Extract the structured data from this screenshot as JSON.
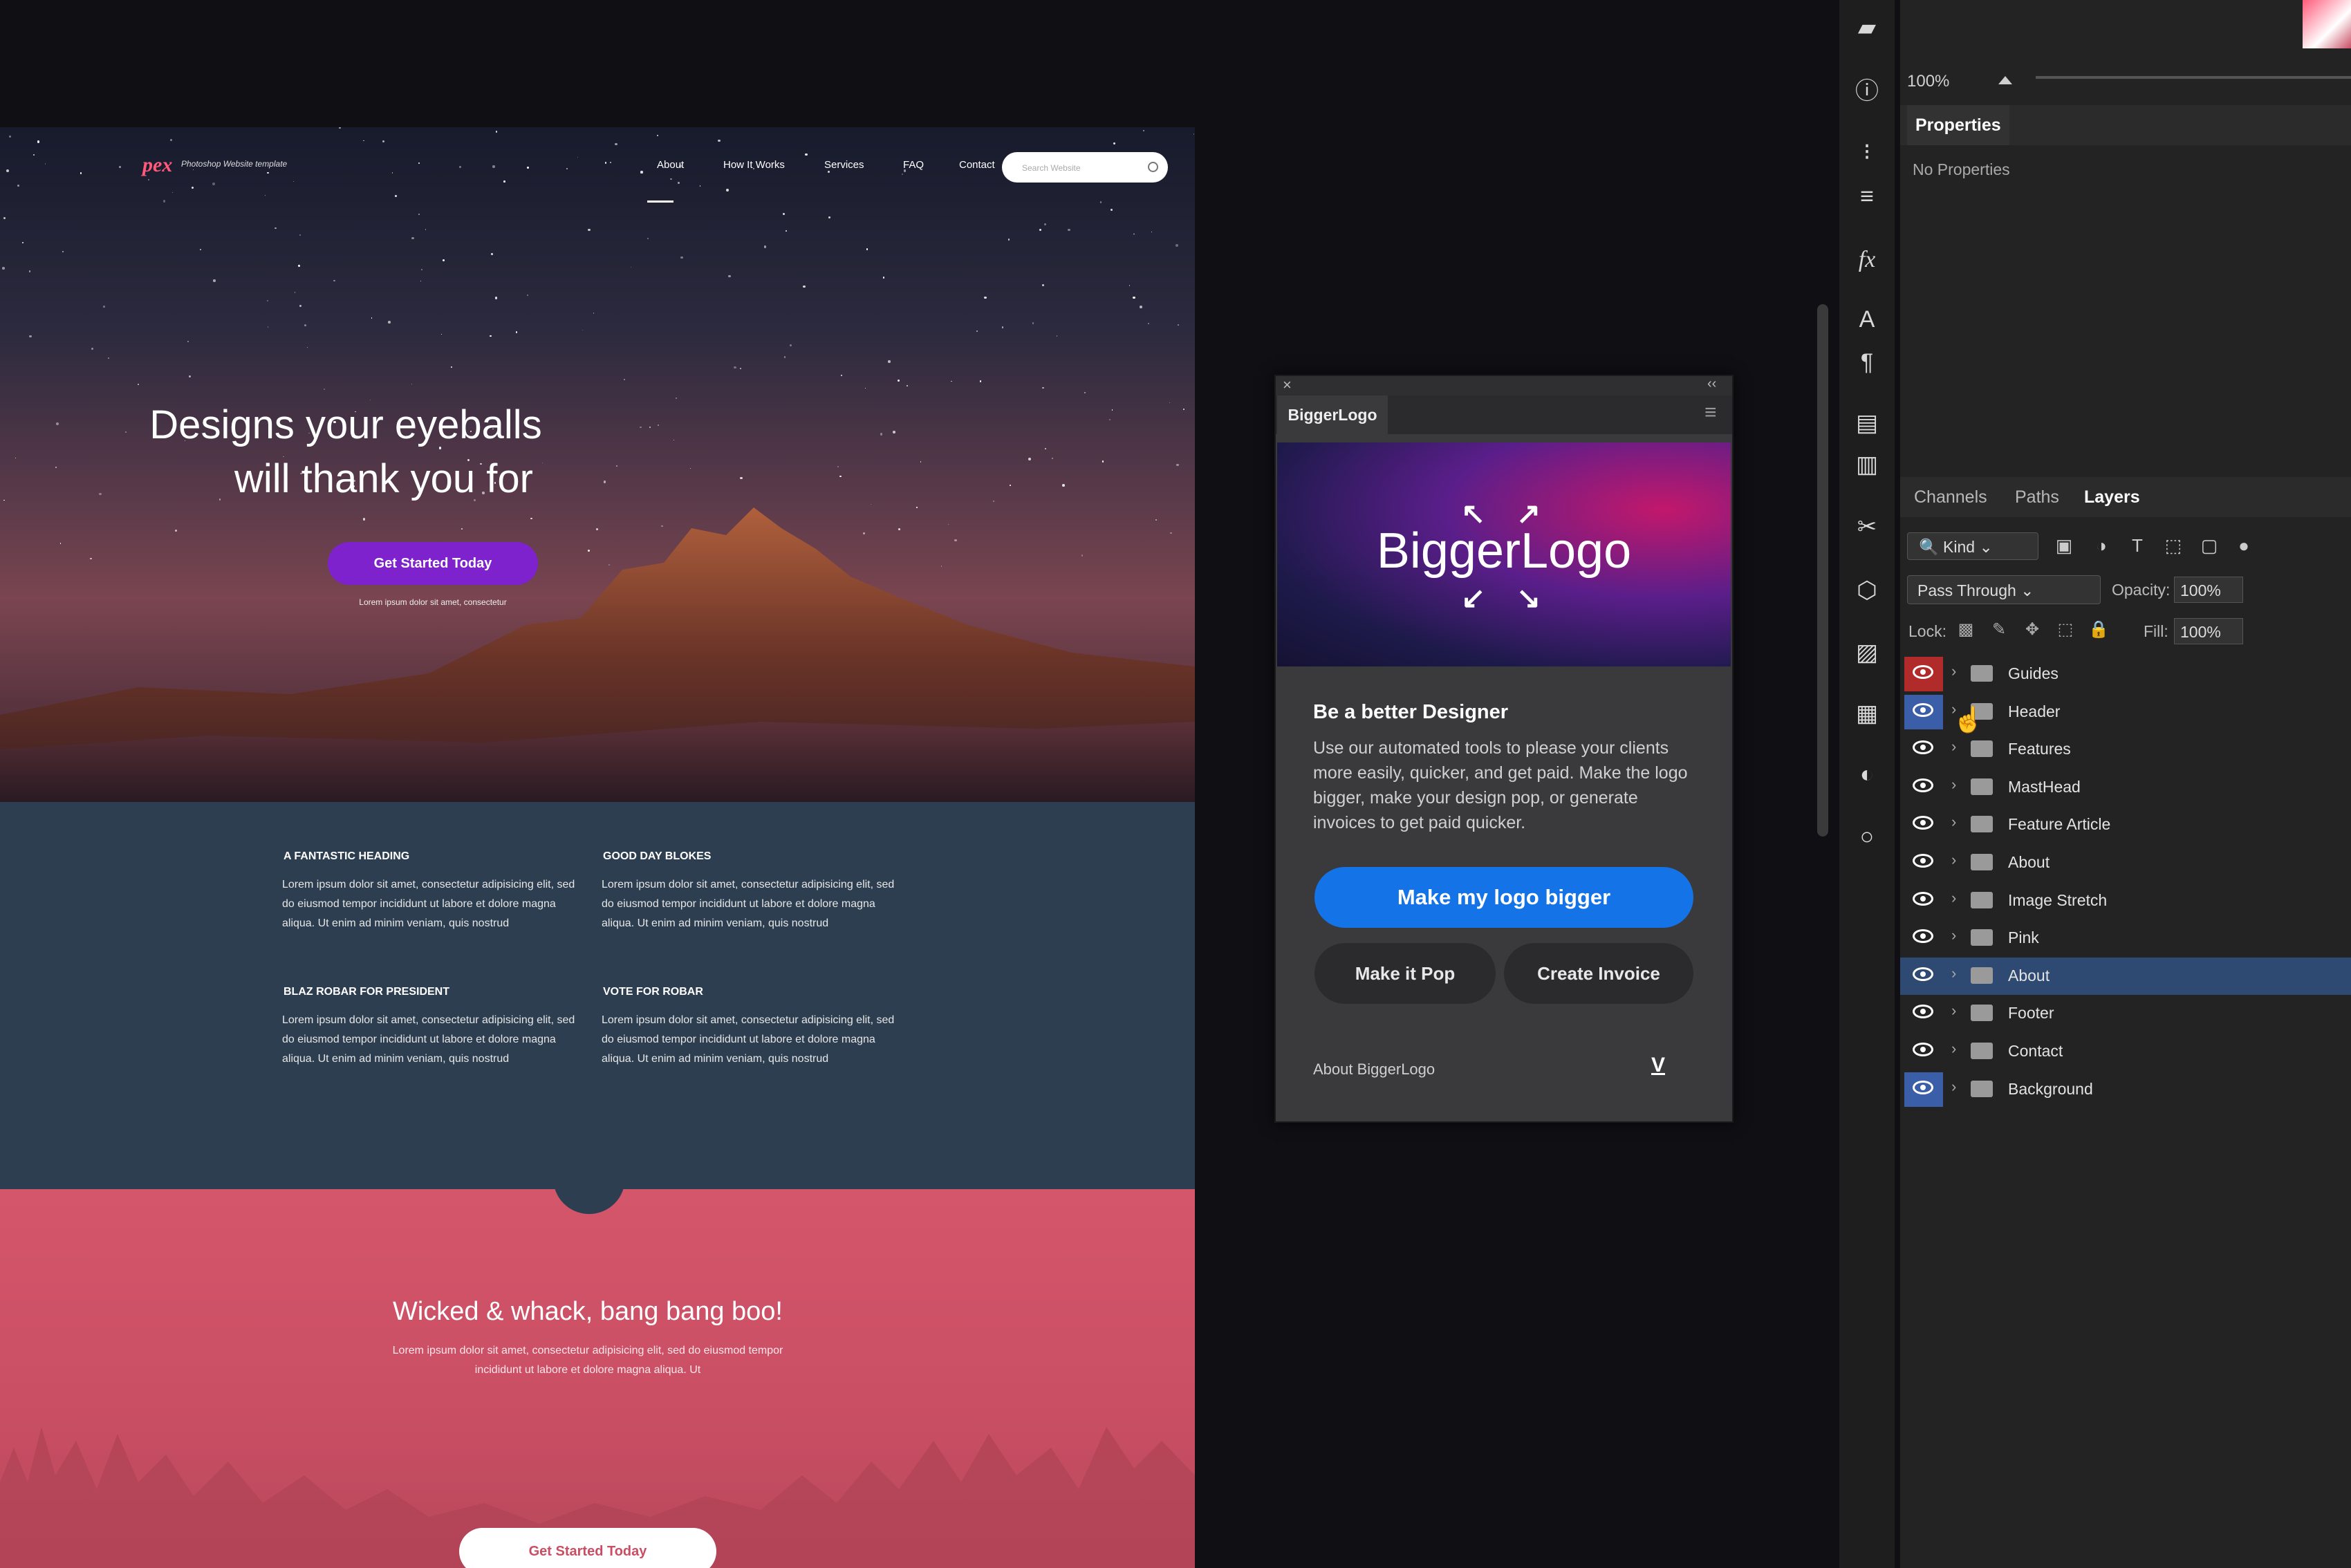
{
  "website": {
    "logo": "pex",
    "logo_sub": "Photoshop Website template",
    "nav": [
      "About",
      "How It Works",
      "Services",
      "FAQ",
      "Contact"
    ],
    "search_placeholder": "Search Website",
    "hero_title_1": "Designs your eyeballs",
    "hero_title_2": "will thank you for",
    "hero_cta": "Get Started Today",
    "hero_small": "Lorem ipsum dolor sit amet, consectetur",
    "features": [
      {
        "heading": "A FANTASTIC HEADING",
        "text": "Lorem ipsum dolor sit amet, consectetur adipisicing elit, sed do eiusmod tempor incididunt ut labore et dolore magna aliqua. Ut enim ad minim veniam, quis nostrud"
      },
      {
        "heading": "GOOD DAY BLOKES",
        "text": "Lorem ipsum dolor sit amet, consectetur adipisicing elit, sed do eiusmod tempor incididunt ut labore et dolore magna aliqua. Ut enim ad minim veniam, quis nostrud"
      },
      {
        "heading": "BLAZ ROBAR FOR PRESIDENT",
        "text": "Lorem ipsum dolor sit amet, consectetur adipisicing elit, sed do eiusmod tempor incididunt ut labore et dolore magna aliqua. Ut enim ad minim veniam, quis nostrud"
      },
      {
        "heading": "VOTE FOR ROBAR",
        "text": "Lorem ipsum dolor sit amet, consectetur adipisicing elit, sed do eiusmod tempor incididunt ut labore et dolore magna aliqua. Ut enim ad minim veniam, quis nostrud"
      }
    ],
    "pink_title": "Wicked & whack, bang bang boo!",
    "pink_text": "Lorem ipsum dolor sit amet, consectetur adipisicing elit, sed do eiusmod tempor incididunt ut labore et dolore magna aliqua. Ut",
    "pink_cta": "Get Started Today"
  },
  "plugin": {
    "tab": "BiggerLogo",
    "banner": "BiggerLogo",
    "heading": "Be a better Designer",
    "description": "Use our automated tools to please your clients more easily, quicker, and get paid. Make the logo bigger, make your design pop, or generate invoices to get paid quicker.",
    "primary_button": "Make my logo bigger",
    "button_pop": "Make it Pop",
    "button_invoice": "Create Invoice",
    "about": "About BiggerLogo",
    "vendor_mark": "V",
    "close_glyph": "×",
    "collapse_glyph": "‹‹",
    "menu_glyph": "≡"
  },
  "photoshop": {
    "zoom": "100%",
    "properties_tab": "Properties",
    "no_properties": "No Properties",
    "tabs": [
      "Channels",
      "Paths",
      "Layers"
    ],
    "active_tab": "Layers",
    "kind_filter": "Kind",
    "blend_mode": "Pass Through",
    "opacity_label": "Opacity:",
    "opacity": "100%",
    "lock_label": "Lock:",
    "fill_label": "Fill:",
    "fill": "100%",
    "layers": [
      {
        "name": "Guides",
        "eye": "red"
      },
      {
        "name": "Header",
        "eye": "blue"
      },
      {
        "name": "Features",
        "eye": "none"
      },
      {
        "name": "MastHead",
        "eye": "none"
      },
      {
        "name": "Feature Article",
        "eye": "none"
      },
      {
        "name": "About",
        "eye": "none"
      },
      {
        "name": "Image Stretch",
        "eye": "none"
      },
      {
        "name": "Pink",
        "eye": "none"
      },
      {
        "name": "About",
        "eye": "none",
        "selected": true
      },
      {
        "name": "Footer",
        "eye": "none"
      },
      {
        "name": "Contact",
        "eye": "none"
      },
      {
        "name": "Background",
        "eye": "blue"
      }
    ],
    "tool_icons": [
      "comment-icon",
      "info-icon",
      "brush-settings-icon",
      "adjustments-icon",
      "fx-icon",
      "character-icon",
      "paragraph-icon",
      "libraries-icon",
      "notes-icon",
      "tools-icon",
      "3d-icon",
      "images-icon",
      "grid-icon",
      "color-icon",
      "shape-icon"
    ]
  },
  "colors": {
    "accent_blue": "#1473e6",
    "hero_cta": "#7e22ce",
    "features_bg": "#2c3e50",
    "pink_bg": "#c94e64",
    "layer_selected": "#2e4a72"
  }
}
